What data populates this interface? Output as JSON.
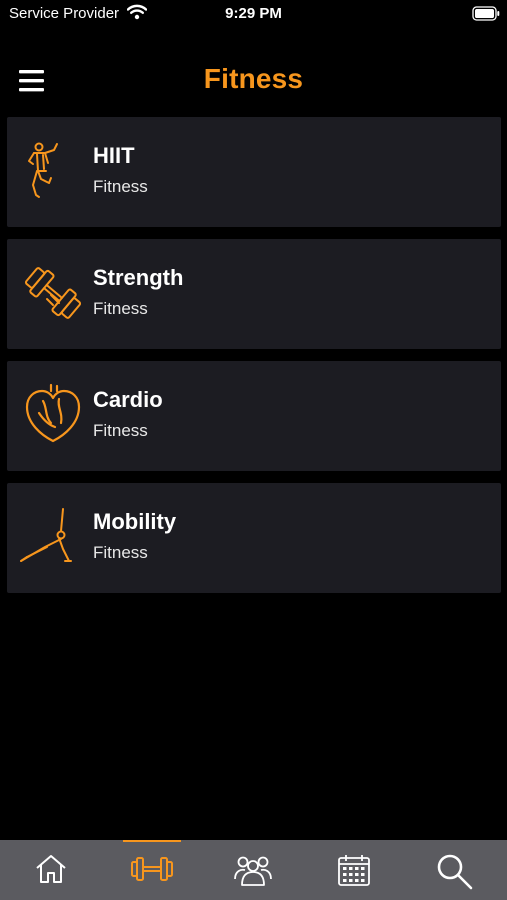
{
  "status_bar": {
    "carrier": "Service Provider",
    "time": "9:29 PM",
    "wifi_icon": "wifi-icon",
    "battery_icon": "battery-icon"
  },
  "header": {
    "title": "Fitness",
    "menu_icon": "hamburger-menu-icon"
  },
  "categories": [
    {
      "title": "HIIT",
      "subtitle": "Fitness",
      "icon": "hiit-figure-icon"
    },
    {
      "title": "Strength",
      "subtitle": "Fitness",
      "icon": "dumbbell-icon"
    },
    {
      "title": "Cardio",
      "subtitle": "Fitness",
      "icon": "heart-icon"
    },
    {
      "title": "Mobility",
      "subtitle": "Fitness",
      "icon": "side-plank-icon"
    }
  ],
  "tabs": [
    {
      "name": "home",
      "icon": "home-icon",
      "active": false
    },
    {
      "name": "fitness",
      "icon": "dumbbell-icon",
      "active": true
    },
    {
      "name": "community",
      "icon": "people-icon",
      "active": false
    },
    {
      "name": "calendar",
      "icon": "calendar-icon",
      "active": false
    },
    {
      "name": "search",
      "icon": "search-icon",
      "active": false
    }
  ],
  "colors": {
    "accent": "#f7961d",
    "card": "#1c1c22",
    "tab_bar": "#5b5b60",
    "background": "#000000"
  }
}
